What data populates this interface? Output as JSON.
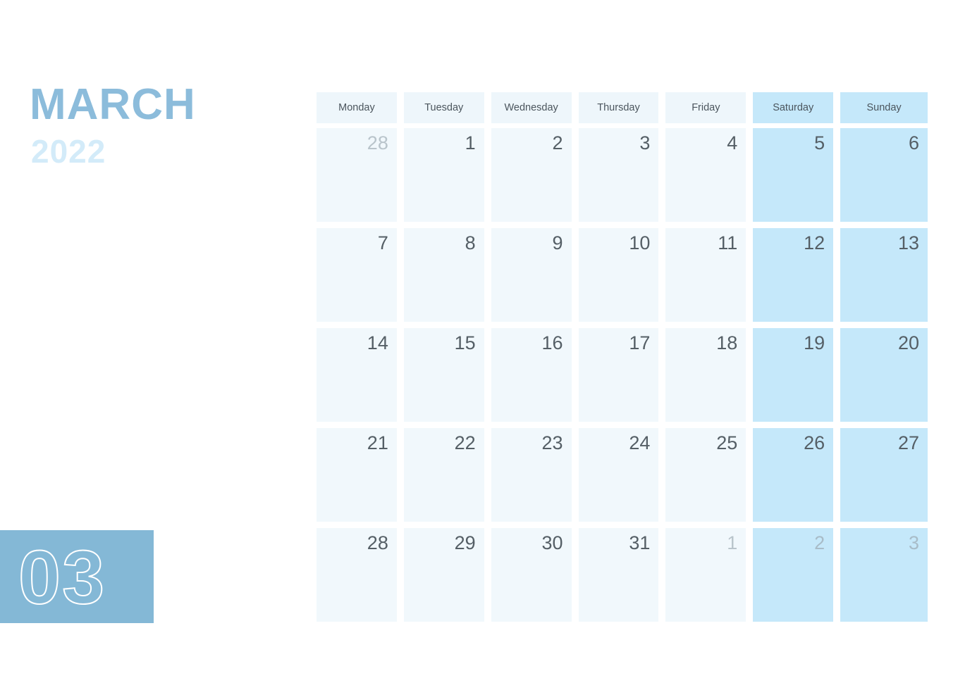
{
  "header": {
    "month_label": "MARCH",
    "year_label": "2022",
    "month_number": "03"
  },
  "colors": {
    "month_title": "#8cbcdb",
    "year_title": "#d3ebf9",
    "badge_background": "#84b8d6",
    "badge_number_stroke": "#ffffff",
    "weekday_header_background": "#eef6fb",
    "weekend_header_background": "#c5e8fa",
    "weekday_cell_background": "#f1f8fc",
    "weekend_cell_background": "#c5e8fa",
    "date_text": "#555f66",
    "other_month_date_text": "#b9c4cb",
    "page_background": "#ffffff"
  },
  "weekdays": [
    {
      "label": "Monday",
      "weekend": false
    },
    {
      "label": "Tuesday",
      "weekend": false
    },
    {
      "label": "Wednesday",
      "weekend": false
    },
    {
      "label": "Thursday",
      "weekend": false
    },
    {
      "label": "Friday",
      "weekend": false
    },
    {
      "label": "Saturday",
      "weekend": true
    },
    {
      "label": "Sunday",
      "weekend": true
    }
  ],
  "weeks": [
    [
      {
        "day": "28",
        "other_month": true,
        "weekend": false
      },
      {
        "day": "1",
        "other_month": false,
        "weekend": false
      },
      {
        "day": "2",
        "other_month": false,
        "weekend": false
      },
      {
        "day": "3",
        "other_month": false,
        "weekend": false
      },
      {
        "day": "4",
        "other_month": false,
        "weekend": false
      },
      {
        "day": "5",
        "other_month": false,
        "weekend": true
      },
      {
        "day": "6",
        "other_month": false,
        "weekend": true
      }
    ],
    [
      {
        "day": "7",
        "other_month": false,
        "weekend": false
      },
      {
        "day": "8",
        "other_month": false,
        "weekend": false
      },
      {
        "day": "9",
        "other_month": false,
        "weekend": false
      },
      {
        "day": "10",
        "other_month": false,
        "weekend": false
      },
      {
        "day": "11",
        "other_month": false,
        "weekend": false
      },
      {
        "day": "12",
        "other_month": false,
        "weekend": true
      },
      {
        "day": "13",
        "other_month": false,
        "weekend": true
      }
    ],
    [
      {
        "day": "14",
        "other_month": false,
        "weekend": false
      },
      {
        "day": "15",
        "other_month": false,
        "weekend": false
      },
      {
        "day": "16",
        "other_month": false,
        "weekend": false
      },
      {
        "day": "17",
        "other_month": false,
        "weekend": false
      },
      {
        "day": "18",
        "other_month": false,
        "weekend": false
      },
      {
        "day": "19",
        "other_month": false,
        "weekend": true
      },
      {
        "day": "20",
        "other_month": false,
        "weekend": true
      }
    ],
    [
      {
        "day": "21",
        "other_month": false,
        "weekend": false
      },
      {
        "day": "22",
        "other_month": false,
        "weekend": false
      },
      {
        "day": "23",
        "other_month": false,
        "weekend": false
      },
      {
        "day": "24",
        "other_month": false,
        "weekend": false
      },
      {
        "day": "25",
        "other_month": false,
        "weekend": false
      },
      {
        "day": "26",
        "other_month": false,
        "weekend": true
      },
      {
        "day": "27",
        "other_month": false,
        "weekend": true
      }
    ],
    [
      {
        "day": "28",
        "other_month": false,
        "weekend": false
      },
      {
        "day": "29",
        "other_month": false,
        "weekend": false
      },
      {
        "day": "30",
        "other_month": false,
        "weekend": false
      },
      {
        "day": "31",
        "other_month": false,
        "weekend": false
      },
      {
        "day": "1",
        "other_month": true,
        "weekend": false
      },
      {
        "day": "2",
        "other_month": true,
        "weekend": true
      },
      {
        "day": "3",
        "other_month": true,
        "weekend": true
      }
    ]
  ]
}
